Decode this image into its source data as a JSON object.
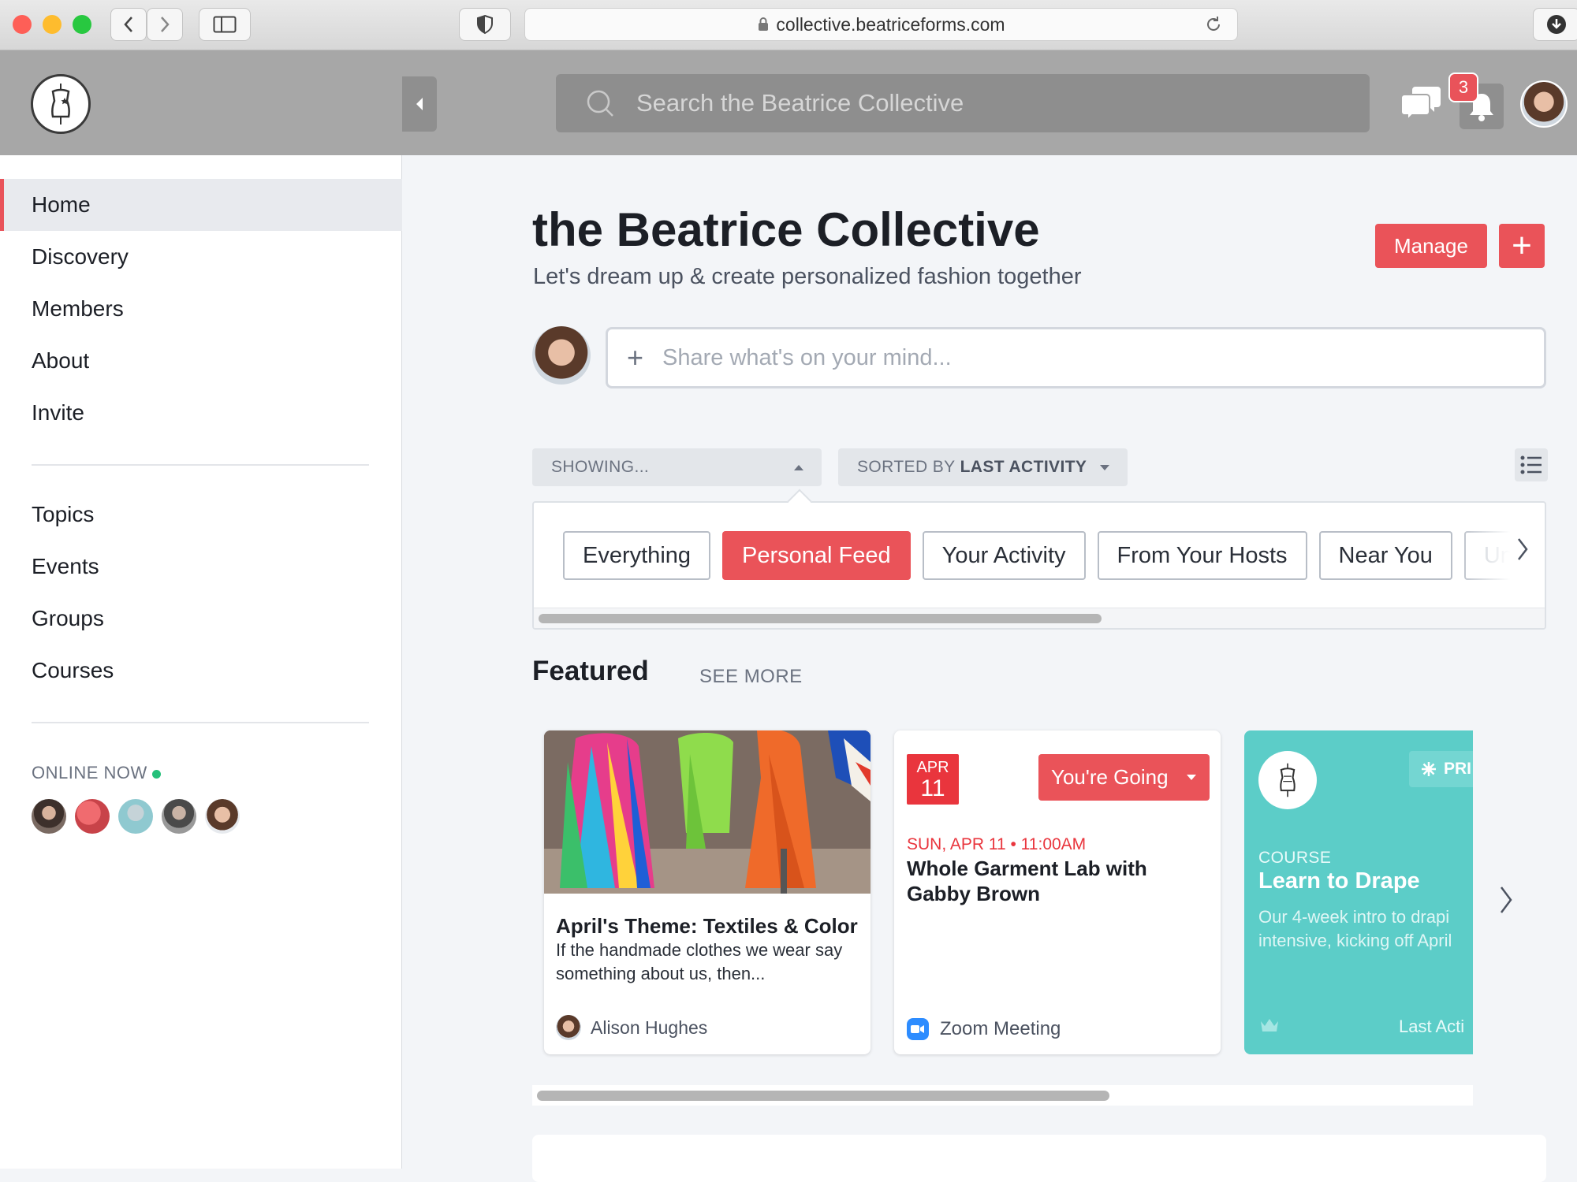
{
  "browser": {
    "url": "collective.beatriceforms.com",
    "traffic_colors": [
      "#fe5f57",
      "#febc2e",
      "#28c840"
    ]
  },
  "sidebar": {
    "nav_primary": [
      {
        "label": "Home",
        "active": true
      },
      {
        "label": "Discovery"
      },
      {
        "label": "Members"
      },
      {
        "label": "About"
      },
      {
        "label": "Invite"
      }
    ],
    "nav_secondary": [
      {
        "label": "Topics"
      },
      {
        "label": "Events"
      },
      {
        "label": "Groups"
      },
      {
        "label": "Courses"
      }
    ],
    "online_label": "ONLINE NOW",
    "online_avatar_colors": [
      "#5b4a44",
      "#e9535a",
      "#8fc9d0",
      "#6b6b6b",
      "#d7b8a5"
    ]
  },
  "header": {
    "search_placeholder": "Search the Beatrice Collective",
    "notification_count": "3"
  },
  "main": {
    "title": "the Beatrice Collective",
    "subtitle": "Let's dream up & create personalized fashion together",
    "manage_label": "Manage",
    "add_label": "+",
    "post_placeholder": "Share what's on your mind...",
    "post_plus": "+",
    "showing_label": "SHOWING...",
    "sorted_prefix": "SORTED BY",
    "sorted_value": "LAST ACTIVITY",
    "feed_filters": [
      {
        "label": "Everything"
      },
      {
        "label": "Personal Feed",
        "active": true
      },
      {
        "label": "Your Activity"
      },
      {
        "label": "From Your Hosts"
      },
      {
        "label": "Near You"
      },
      {
        "label": "Un"
      }
    ],
    "featured_title": "Featured",
    "see_more": "SEE MORE",
    "cards": {
      "post": {
        "title": "April's Theme: Textiles & Color",
        "excerpt": "If the handmade clothes we wear say something about us, then...",
        "author": "Alison Hughes"
      },
      "event": {
        "month": "APR",
        "day": "11",
        "going_label": "You're Going",
        "when": "SUN, APR 11 • 11:00AM",
        "title": "Whole Garment Lab with Gabby Brown",
        "location": "Zoom Meeting"
      },
      "course": {
        "tag": "PRI",
        "label": "COURSE",
        "title": "Learn to Drape",
        "description_line1": "Our 4-week intro to drapi",
        "description_line2": "intensive, kicking off April",
        "last_activity": "Last Acti"
      }
    }
  },
  "colors": {
    "accent": "#ea5359",
    "course_teal": "#5ccdc8",
    "online_green": "#25c07a"
  }
}
